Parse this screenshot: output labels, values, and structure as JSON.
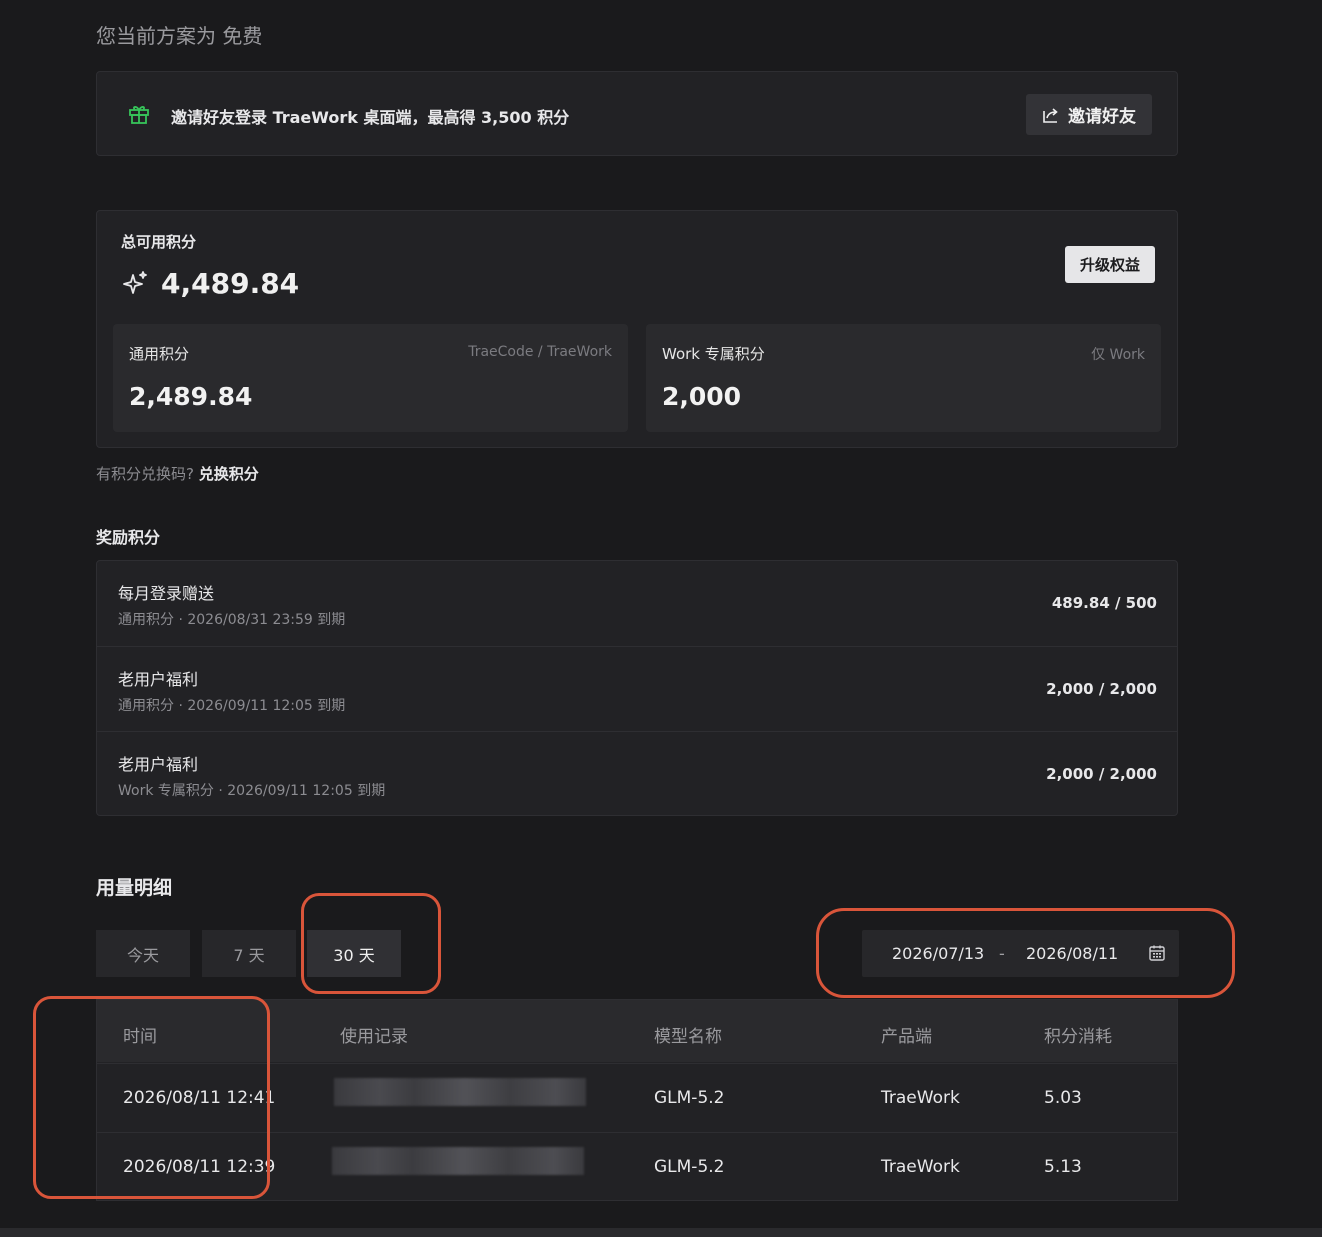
{
  "plan": {
    "text": "您当前方案为 免费"
  },
  "invite": {
    "icon": "gift-icon",
    "icon_color": "#37c45a",
    "text": "邀请好友登录 TraeWork 桌面端，最高得 3,500 积分",
    "button_label": "邀请好友",
    "button_icon": "share-icon"
  },
  "credits": {
    "total_label": "总可用积分",
    "total_value": "4,489.84",
    "total_icon": "sparkle-icon",
    "upgrade_label": "升级权益",
    "general": {
      "label": "通用积分",
      "scope": "TraeCode / TraeWork",
      "value": "2,489.84"
    },
    "work": {
      "label": "Work 专属积分",
      "scope": "仅 Work",
      "value": "2,000"
    }
  },
  "redeem": {
    "prompt": "有积分兑换码?",
    "link": "兑换积分"
  },
  "rewards": {
    "title": "奖励积分",
    "items": [
      {
        "name": "每月登录赠送",
        "meta": "通用积分 · 2026/08/31 23:59 到期",
        "value": "489.84 / 500"
      },
      {
        "name": "老用户福利",
        "meta": "通用积分 · 2026/09/11 12:05 到期",
        "value": "2,000 / 2,000"
      },
      {
        "name": "老用户福利",
        "meta": "Work 专属积分 · 2026/09/11 12:05 到期",
        "value": "2,000 / 2,000"
      }
    ]
  },
  "usage": {
    "title": "用量明细",
    "tabs": [
      {
        "label": "今天",
        "active": false
      },
      {
        "label": "7 天",
        "active": false
      },
      {
        "label": "30 天",
        "active": true
      }
    ],
    "date_range": {
      "start": "2026/07/13",
      "separator": "-",
      "end": "2026/08/11",
      "icon": "calendar-icon"
    },
    "columns": [
      "时间",
      "使用记录",
      "模型名称",
      "产品端",
      "积分消耗"
    ],
    "rows": [
      {
        "time": "2026/08/11 12:41",
        "model": "GLM-5.2",
        "product": "TraeWork",
        "cost": "5.03"
      },
      {
        "time": "2026/08/11 12:39",
        "model": "GLM-5.2",
        "product": "TraeWork",
        "cost": "5.13"
      }
    ]
  },
  "colors": {
    "background": "#1a1a1c",
    "card": "#222225",
    "annotation": "#d9553a"
  }
}
